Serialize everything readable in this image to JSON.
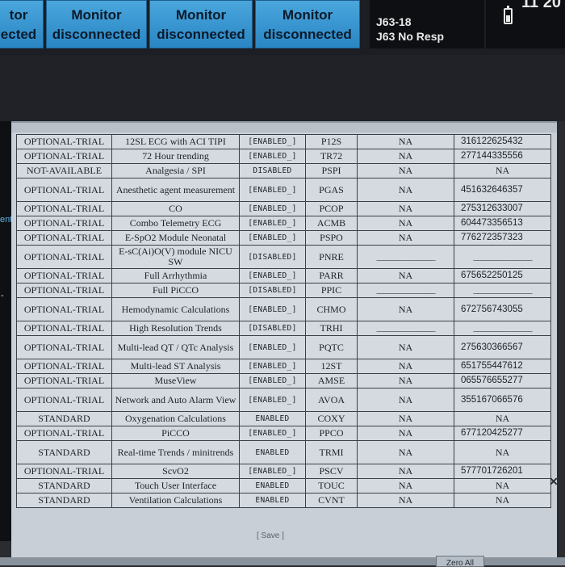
{
  "top_bar": {
    "monitors": [
      {
        "line1": "tor",
        "line2": "ected"
      },
      {
        "line1": "Monitor",
        "line2": "disconnected"
      },
      {
        "line1": "Monitor",
        "line2": "disconnected"
      },
      {
        "line1": "Monitor",
        "line2": "disconnected"
      }
    ],
    "alarm": {
      "line1": "J63-18",
      "line2": "J63 No Resp"
    },
    "clock": "11 20"
  },
  "left_fragments": {
    "ent": "ent",
    "arrow": "-"
  },
  "table": {
    "rows": [
      {
        "type": "OPTIONAL-TRIAL",
        "name": "12SL ECG with ACI TIPI",
        "status": "[ENABLED_]",
        "code": "P12S",
        "na": "NA",
        "key": "316122625432",
        "tall": false
      },
      {
        "type": "OPTIONAL-TRIAL",
        "name": "72 Hour trending",
        "status": "[ENABLED_]",
        "code": "TR72",
        "na": "NA",
        "key": "277144335556",
        "tall": false
      },
      {
        "type": "NOT-AVAILABLE",
        "name": "Analgesia / SPI",
        "status": "DISABLED",
        "code": "PSPI",
        "na": "NA",
        "key": "NA",
        "tall": false
      },
      {
        "type": "OPTIONAL-TRIAL",
        "name": "Anesthetic agent measurement",
        "status": "[ENABLED_]",
        "code": "PGAS",
        "na": "NA",
        "key": "451632646357",
        "tall": true
      },
      {
        "type": "OPTIONAL-TRIAL",
        "name": "CO",
        "status": "[ENABLED_]",
        "code": "PCOP",
        "na": "NA",
        "key": "275312633007",
        "tall": false
      },
      {
        "type": "OPTIONAL-TRIAL",
        "name": "Combo Telemetry ECG",
        "status": "[ENABLED_]",
        "code": "ACMB",
        "na": "NA",
        "key": "604473356513",
        "tall": false
      },
      {
        "type": "OPTIONAL-TRIAL",
        "name": "E-SpO2 Module Neonatal",
        "status": "[ENABLED_]",
        "code": "PSPO",
        "na": "NA",
        "key": "776272357323",
        "tall": false
      },
      {
        "type": "OPTIONAL-TRIAL",
        "name": "E-sC(Ai)O(V) module NICU SW",
        "status": "[DISABLED]",
        "code": "PNRE",
        "na": "________________",
        "key": "________________",
        "tall": true
      },
      {
        "type": "OPTIONAL-TRIAL",
        "name": "Full Arrhythmia",
        "status": "[ENABLED_]",
        "code": "PARR",
        "na": "NA",
        "key": "675652250125",
        "tall": false
      },
      {
        "type": "OPTIONAL-TRIAL",
        "name": "Full PiCCO",
        "status": "[DISABLED]",
        "code": "PPIC",
        "na": "________________",
        "key": "________________",
        "tall": false
      },
      {
        "type": "OPTIONAL-TRIAL",
        "name": "Hemodynamic Calculations",
        "status": "[ENABLED_]",
        "code": "CHMO",
        "na": "NA",
        "key": "672756743055",
        "tall": true
      },
      {
        "type": "OPTIONAL-TRIAL",
        "name": "High Resolution Trends",
        "status": "[DISABLED]",
        "code": "TRHI",
        "na": "________________",
        "key": "________________",
        "tall": false
      },
      {
        "type": "OPTIONAL-TRIAL",
        "name": "Multi-lead QT / QTc Analysis",
        "status": "[ENABLED_]",
        "code": "PQTC",
        "na": "NA",
        "key": "275630366567",
        "tall": true
      },
      {
        "type": "OPTIONAL-TRIAL",
        "name": "Multi-lead ST Analysis",
        "status": "[ENABLED_]",
        "code": "12ST",
        "na": "NA",
        "key": "651755447612",
        "tall": false
      },
      {
        "type": "OPTIONAL-TRIAL",
        "name": "MuseView",
        "status": "[ENABLED_]",
        "code": "AMSE",
        "na": "NA",
        "key": "065576655277",
        "tall": false
      },
      {
        "type": "OPTIONAL-TRIAL",
        "name": "Network and Auto Alarm View",
        "status": "[ENABLED_]",
        "code": "AVOA",
        "na": "NA",
        "key": "355167066576",
        "tall": true
      },
      {
        "type": "STANDARD",
        "name": "Oxygenation Calculations",
        "status": "ENABLED",
        "code": "COXY",
        "na": "NA",
        "key": "NA",
        "tall": false
      },
      {
        "type": "OPTIONAL-TRIAL",
        "name": "PiCCO",
        "status": "[ENABLED_]",
        "code": "PPCO",
        "na": "NA",
        "key": "677120425277",
        "tall": false
      },
      {
        "type": "STANDARD",
        "name": "Real-time Trends / minitrends",
        "status": "ENABLED",
        "code": "TRMI",
        "na": "NA",
        "key": "NA",
        "tall": true
      },
      {
        "type": "OPTIONAL-TRIAL",
        "name": "ScvO2",
        "status": "[ENABLED_]",
        "code": "PSCV",
        "na": "NA",
        "key": "577701726201",
        "tall": false
      },
      {
        "type": "STANDARD",
        "name": "Touch User Interface",
        "status": "ENABLED",
        "code": "TOUC",
        "na": "NA",
        "key": "NA",
        "tall": false
      },
      {
        "type": "STANDARD",
        "name": "Ventilation Calculations",
        "status": "ENABLED",
        "code": "CVNT",
        "na": "NA",
        "key": "NA",
        "tall": false
      }
    ]
  },
  "save_label": "[ Save ]",
  "bottom_buttons": [
    "Zero All"
  ],
  "scroll_glyph": "✕"
}
